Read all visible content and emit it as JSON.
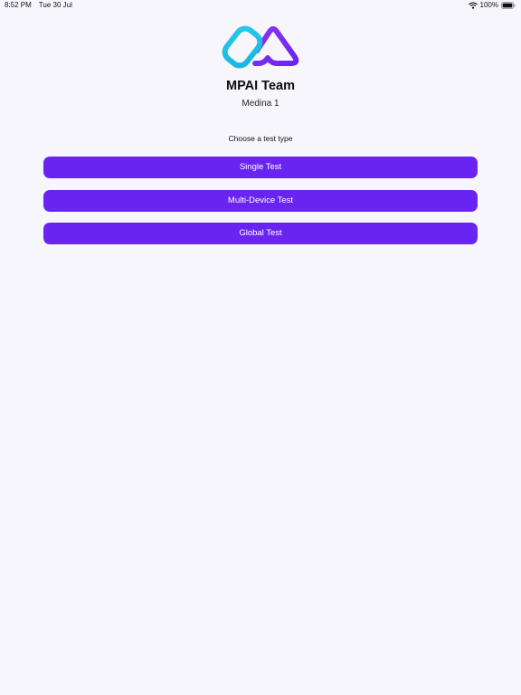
{
  "status_bar": {
    "time": "8:52 PM",
    "date": "Tue 30 Jul",
    "battery_percent": "100%",
    "wifi_icon": "wifi-icon",
    "battery_icon": "battery-full-icon"
  },
  "header": {
    "logo_icon": "linked-shapes-logo",
    "team_name": "MPAI Team",
    "location": "Medina 1"
  },
  "main": {
    "prompt": "Choose a test type",
    "buttons": [
      {
        "label": "Single Test"
      },
      {
        "label": "Multi-Device Test"
      },
      {
        "label": "Global Test"
      }
    ]
  },
  "colors": {
    "background": "#F7F6FC",
    "button": "#6A24F1",
    "logo_cyan": "#1EC6E6",
    "logo_purple": "#7A2BF0"
  }
}
